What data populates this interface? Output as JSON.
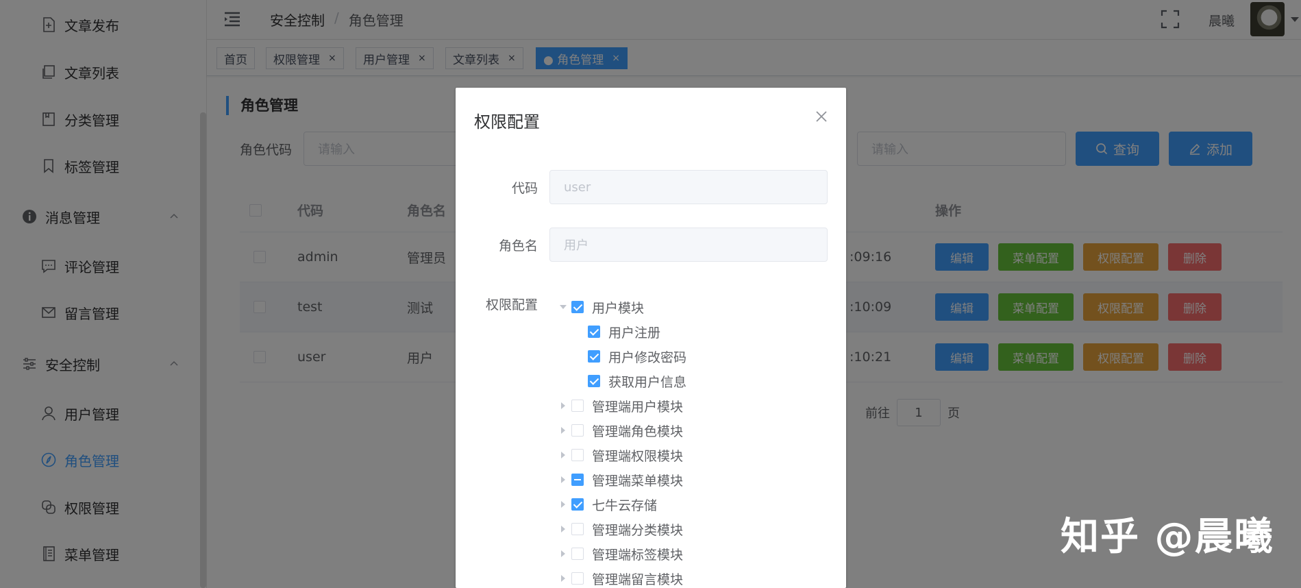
{
  "sidebar": {
    "items": [
      {
        "label": "文章发布",
        "icon": "document-add-icon"
      },
      {
        "label": "文章列表",
        "icon": "document-copy-icon"
      },
      {
        "label": "分类管理",
        "icon": "folder-icon"
      },
      {
        "label": "标签管理",
        "icon": "bookmark-icon"
      },
      {
        "label": "消息管理",
        "icon": "info-icon"
      },
      {
        "label": "评论管理",
        "icon": "chat-icon"
      },
      {
        "label": "留言管理",
        "icon": "message-icon"
      },
      {
        "label": "安全控制",
        "icon": "sliders-icon"
      },
      {
        "label": "用户管理",
        "icon": "user-icon"
      },
      {
        "label": "角色管理",
        "icon": "compass-icon"
      },
      {
        "label": "权限管理",
        "icon": "copy-icon"
      },
      {
        "label": "菜单管理",
        "icon": "notebook-icon"
      }
    ]
  },
  "header": {
    "breadcrumb": [
      "安全控制",
      "/",
      "角色管理"
    ],
    "username": "晨曦"
  },
  "tags": [
    {
      "label": "首页",
      "closable": false
    },
    {
      "label": "权限管理",
      "closable": true
    },
    {
      "label": "用户管理",
      "closable": true
    },
    {
      "label": "文章列表",
      "closable": true
    },
    {
      "label": "● 角色管理",
      "closable": true,
      "active": true
    }
  ],
  "tag_close": "×",
  "main": {
    "title": "角色管理",
    "filter_label": "角色代码",
    "placeholder": "请输入",
    "search_button": "查询",
    "add_button": "添加",
    "table": {
      "headers": [
        "代码",
        "角色名",
        "操作"
      ],
      "rows": [
        {
          "code": "admin",
          "name": "管理员",
          "time": ":09:16"
        },
        {
          "code": "test",
          "name": "测试",
          "time": ":10:09"
        },
        {
          "code": "user",
          "name": "用户",
          "time": ":10:21"
        }
      ],
      "actions": [
        "编辑",
        "菜单配置",
        "权限配置",
        "删除"
      ]
    },
    "pager": {
      "goto": "前往",
      "page": "1",
      "suffix": "页"
    }
  },
  "dialog": {
    "title": "权限配置",
    "code_label": "代码",
    "code_value": "user",
    "name_label": "角色名",
    "name_value": "用户",
    "perm_label": "权限配置",
    "tree": [
      {
        "label": "用户模块",
        "state": "checked",
        "level": 0,
        "expanded": true
      },
      {
        "label": "用户注册",
        "state": "checked",
        "level": 1
      },
      {
        "label": "用户修改密码",
        "state": "checked",
        "level": 1
      },
      {
        "label": "获取用户信息",
        "state": "checked",
        "level": 1
      },
      {
        "label": "管理端用户模块",
        "state": "unchecked",
        "level": 0
      },
      {
        "label": "管理端角色模块",
        "state": "unchecked",
        "level": 0
      },
      {
        "label": "管理端权限模块",
        "state": "unchecked",
        "level": 0
      },
      {
        "label": "管理端菜单模块",
        "state": "half",
        "level": 0
      },
      {
        "label": "七牛云存储",
        "state": "checked",
        "level": 0
      },
      {
        "label": "管理端分类模块",
        "state": "unchecked",
        "level": 0
      },
      {
        "label": "管理端标签模块",
        "state": "unchecked",
        "level": 0
      },
      {
        "label": "管理端留言模块",
        "state": "unchecked",
        "level": 0
      }
    ]
  },
  "watermark": "知乎 @晨曦",
  "colors": {
    "primary": "#409eff",
    "success": "#67c23a",
    "warning": "#e6a23c",
    "danger": "#f56c6c"
  }
}
